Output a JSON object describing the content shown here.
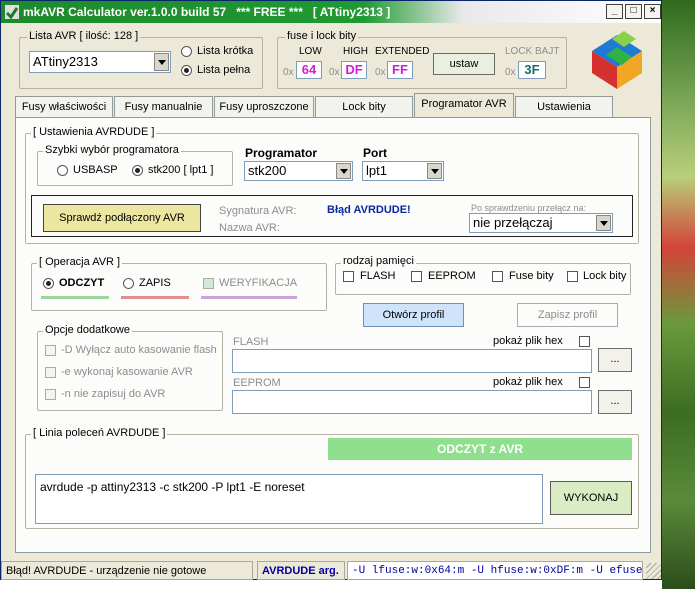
{
  "window": {
    "title": "mkAVR Calculator ver.1.0.0 build 57   *** FREE ***   [ ATtiny2313 ]",
    "minimize_glyph": "_",
    "maximize_glyph": "□",
    "close_glyph": "×"
  },
  "lista_avr": {
    "group_label": "Lista AVR [ ilość: 128 ]",
    "selected": "ATtiny2313",
    "radio_short": "Lista krótka",
    "radio_full": "Lista pełna"
  },
  "fuses": {
    "group_label": "fuse i lock bity",
    "low_label": "LOW",
    "high_label": "HIGH",
    "ext_label": "EXTENDED",
    "lock_label": "LOCK BAJT",
    "prefix": "0x",
    "low": "64",
    "high": "DF",
    "ext": "FF",
    "lock": "3F",
    "set_button": "ustaw"
  },
  "tabs": [
    {
      "label": "Fusy właściwości"
    },
    {
      "label": "Fusy manualnie"
    },
    {
      "label": "Fusy uproszczone"
    },
    {
      "label": "Lock bity"
    },
    {
      "label": "Programator AVR"
    },
    {
      "label": "Ustawienia"
    }
  ],
  "avrdude": {
    "group_label": "[ Ustawienia AVRDUDE ]",
    "quick_label": "Szybki wybór programatora",
    "quick_usbasp": "USBASP",
    "quick_stk200": "stk200 [ lpt1 ]",
    "programmer_label": "Programator",
    "programmer_value": "stk200",
    "port_label": "Port",
    "port_value": "lpt1",
    "check_button": "Sprawdź podłączony AVR",
    "signature_label": "Sygnatura AVR:",
    "signature_value": "Błąd AVRDUDE!",
    "name_label": "Nazwa AVR:",
    "after_check_label": "Po sprawdzeniu przełącz na:",
    "after_check_value": "nie przełączaj"
  },
  "operation": {
    "group_label": "[ Operacja AVR ]",
    "read": "ODCZYT",
    "write": "ZAPIS",
    "verify": "WERYFIKACJA"
  },
  "memory": {
    "group_label": "rodzaj pamięci",
    "flash": "FLASH",
    "eeprom": "EEPROM",
    "fuse": "Fuse bity",
    "lock": "Lock bity"
  },
  "profile": {
    "open": "Otwórz profil",
    "save": "Zapisz profil"
  },
  "options": {
    "group_label": "Opcje dodatkowe",
    "opt_d": "-D Wyłącz auto kasowanie flash",
    "opt_e": "-e wykonaj kasowanie AVR",
    "opt_n": "-n nie zapisuj do AVR"
  },
  "files": {
    "flash_label": "FLASH",
    "eeprom_label": "EEPROM",
    "show_hex": "pokaż plik hex",
    "browse": "..."
  },
  "command": {
    "group_label": "[ Linia poleceń AVRDUDE ]",
    "status_banner": "ODCZYT z AVR",
    "command_line": "avrdude -p attiny2313 -c stk200 -P lpt1 -E noreset",
    "execute": "WYKONAJ"
  },
  "statusbar": {
    "message": "Błąd! AVRDUDE - urządzenie nie gotowe",
    "args_label": "AVRDUDE arg.",
    "args_value": "-U lfuse:w:0x64:m  -U hfuse:w:0xDF:m  -U efuse"
  },
  "colors": {
    "title_green": "#1f9a33",
    "hex_magenta": "#d81bd8",
    "hex_teal": "#1a6e6e",
    "banner_green": "#8fdf8f",
    "read_underline": "#9ad79a",
    "write_underline": "#e08f8f",
    "verify_underline": "#c9a3d9",
    "args_blue": "#0000a0"
  }
}
